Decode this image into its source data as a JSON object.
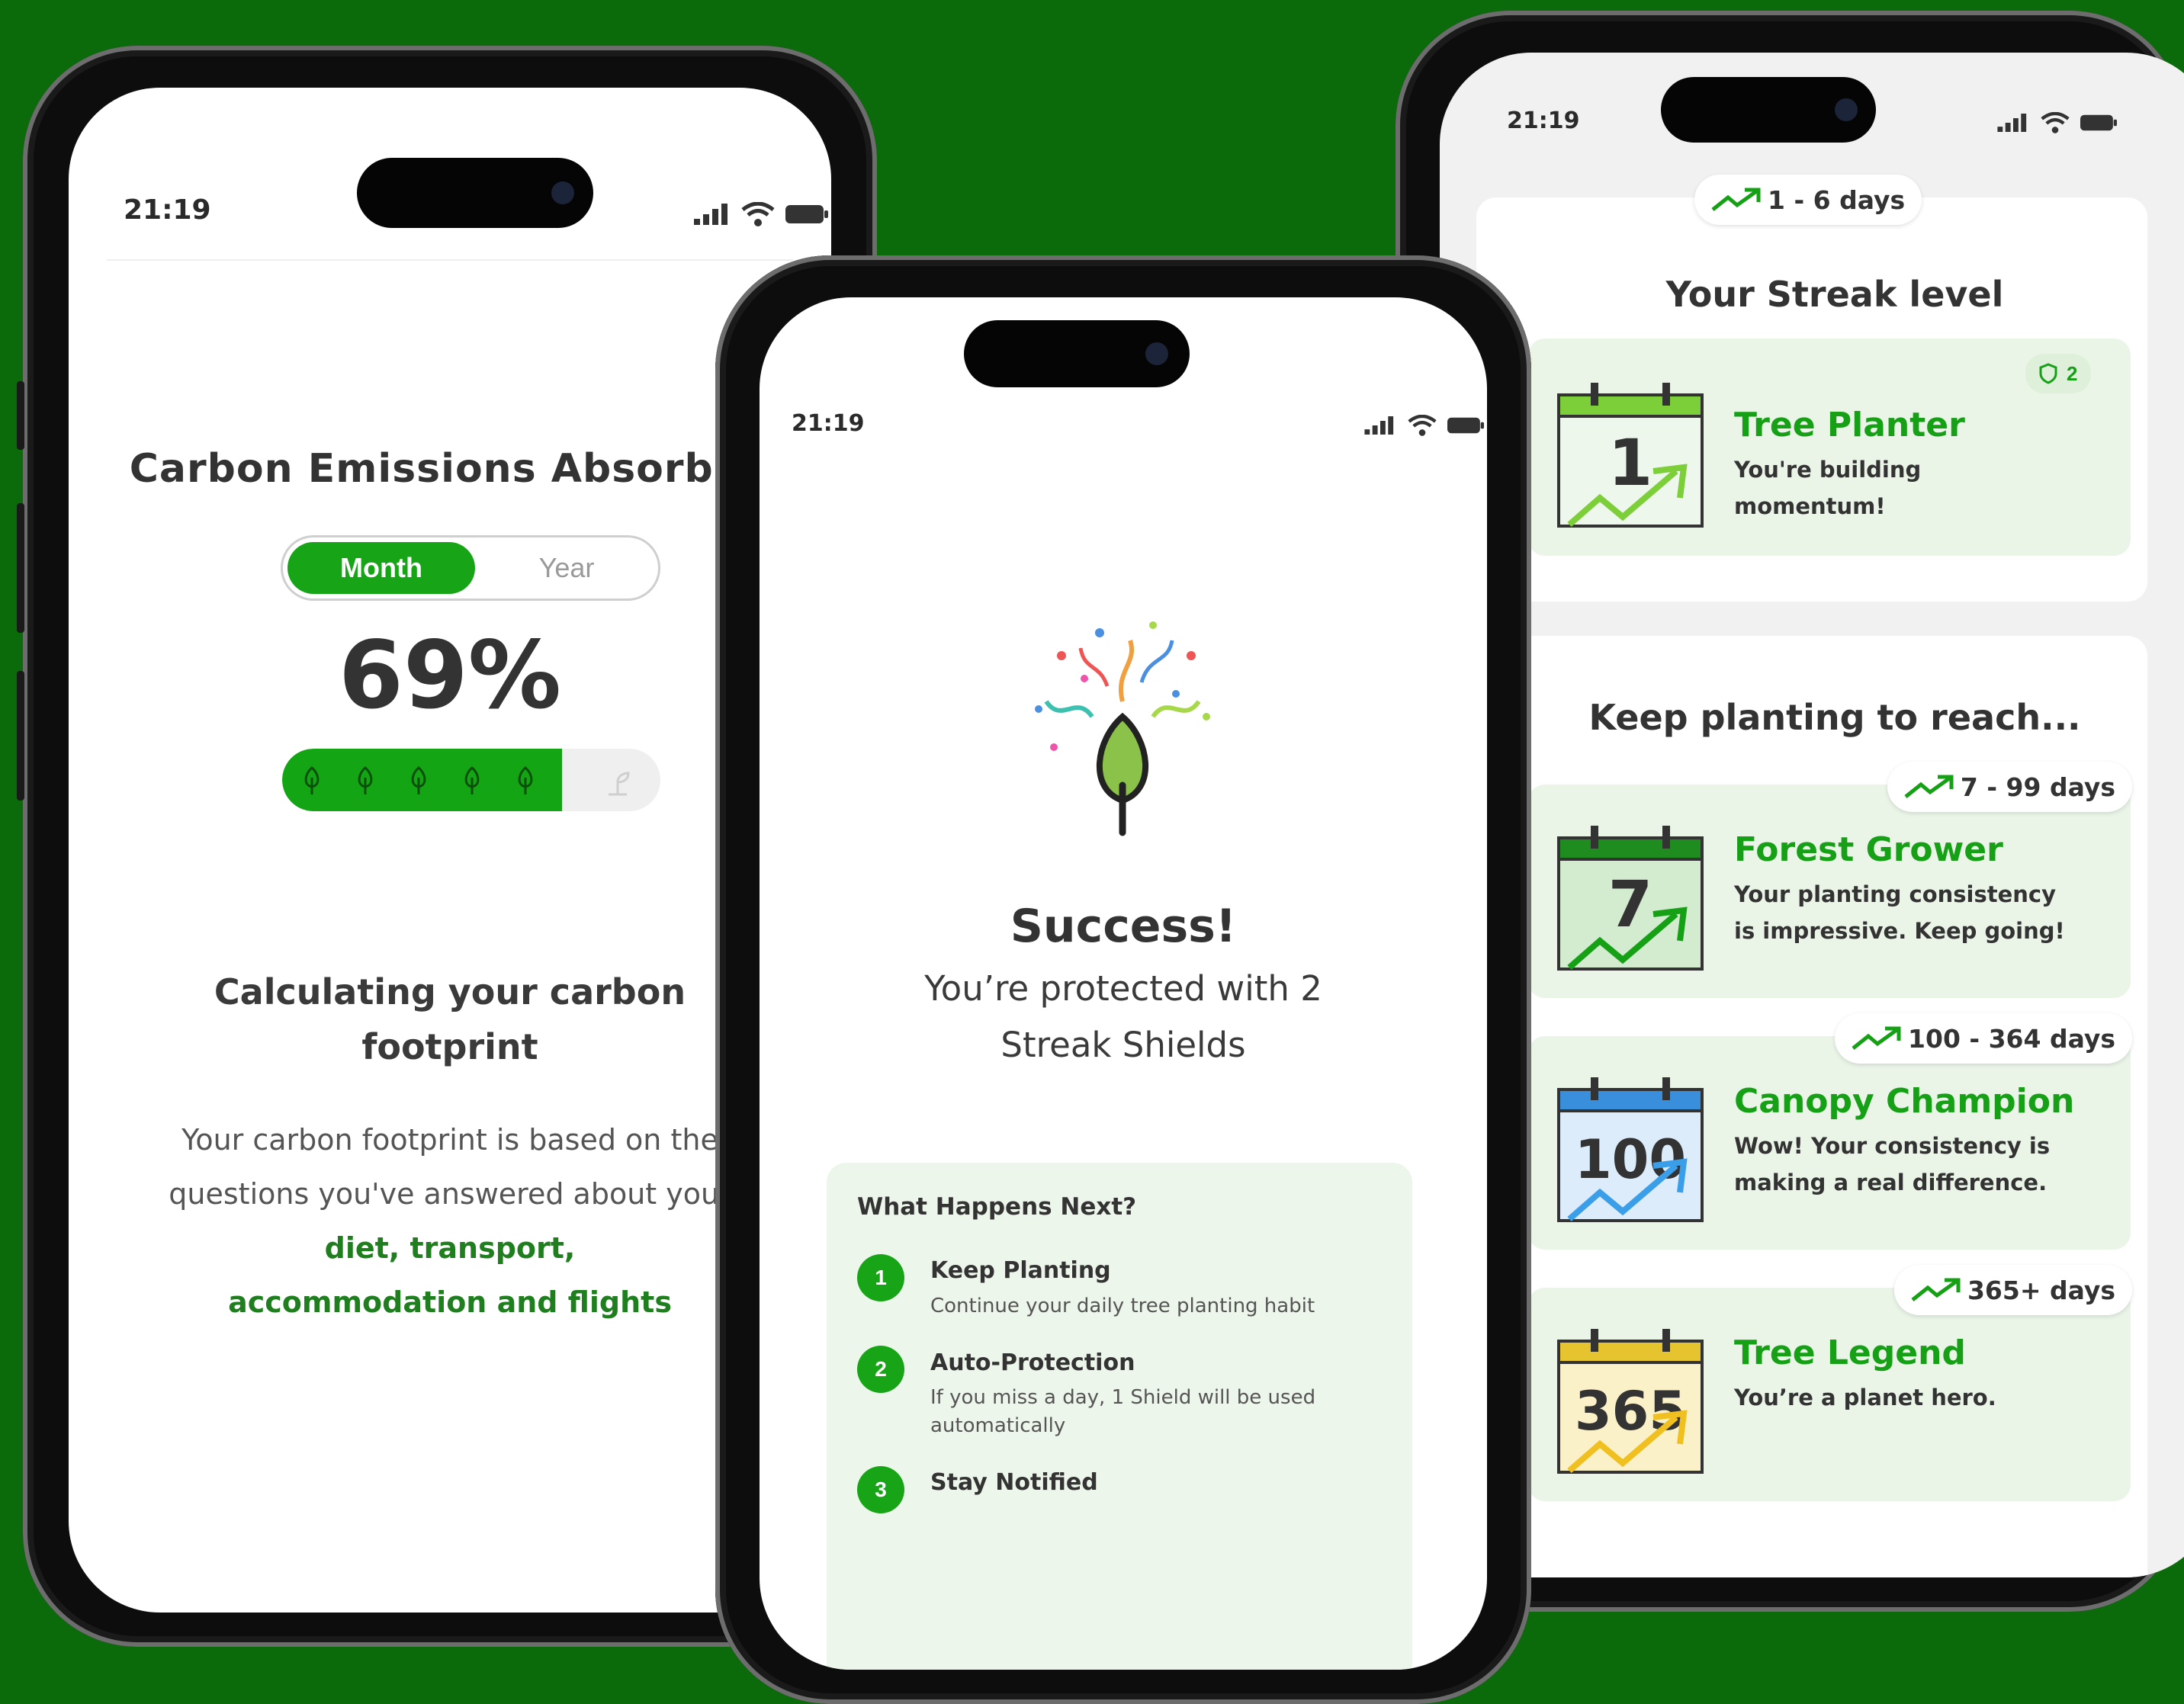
{
  "colors": {
    "background": "#0b6b0b",
    "accent": "#17a517",
    "highlight_text": "#1f7f1f"
  },
  "phone1": {
    "time": "21:19",
    "title": "Carbon Emissions Absorbed",
    "toggle": {
      "month": "Month",
      "year": "Year",
      "selected": "Month"
    },
    "percent_label": "69%",
    "progress_fraction": 0.74,
    "calc_title": "Calculating your carbon footprint",
    "calc_body": "Your carbon footprint is based on the questions you've answered about your",
    "calc_highlight_1": "diet, transport,",
    "calc_highlight_2": "accommodation and flights"
  },
  "phone2": {
    "time": "21:19",
    "success": "Success!",
    "protected_text": "You’re protected with 2 Streak Shields",
    "next_title": "What Happens Next?",
    "steps": [
      {
        "num": "1",
        "title": "Keep Planting",
        "desc": "Continue your daily tree planting habit"
      },
      {
        "num": "2",
        "title": "Auto-Protection",
        "desc": "If you miss a day, 1 Shield will be used automatically"
      },
      {
        "num": "3",
        "title": "Stay Notified",
        "desc": ""
      }
    ]
  },
  "phone3": {
    "time": "21:19",
    "current_range": "1 - 6 days",
    "streak_title": "Your Streak level",
    "current_level": {
      "day": "1",
      "name": "Tree Planter",
      "desc": "You're building momentum!",
      "shields": "2"
    },
    "reach_title": "Keep planting to reach...",
    "levels": [
      {
        "range": "7 - 99 days",
        "day": "7",
        "name": "Forest Grower",
        "desc": "Your planting consistency is impressive. Keep going!",
        "color": "#1e8c1e",
        "fill": "#d3ecd0",
        "arrow": "#16a016"
      },
      {
        "range": "100 - 364 days",
        "day": "100",
        "name": "Canopy Champion",
        "desc": "Wow! Your consistency is making a real difference.",
        "color": "#3a8fdc",
        "fill": "#dcecfb",
        "arrow": "#3a9fe8"
      },
      {
        "range": "365+ days",
        "day": "365",
        "name": "Tree Legend",
        "desc": "You’re a planet hero.",
        "color": "#e6c430",
        "fill": "#fbf1c8",
        "arrow": "#f0c020"
      }
    ]
  }
}
